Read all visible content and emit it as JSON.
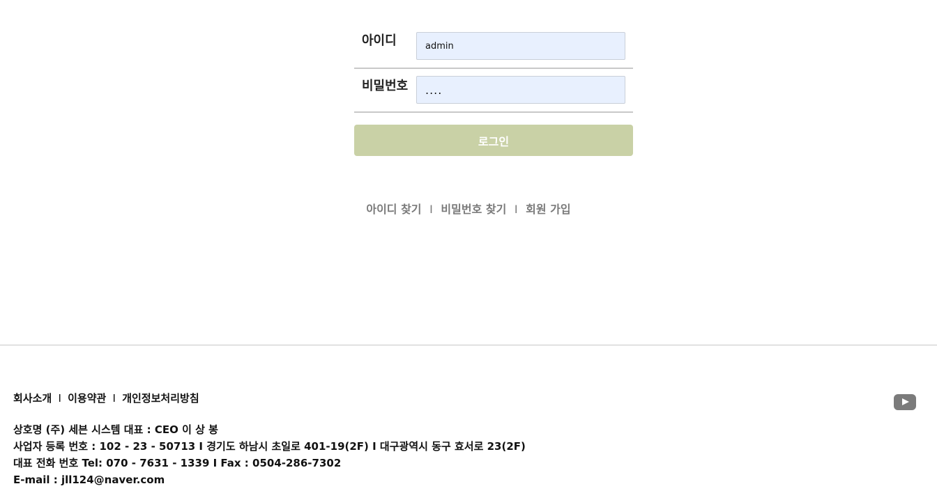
{
  "login": {
    "id_label": "아이디",
    "id_value": "admin",
    "pw_label": "비밀번호",
    "pw_value": "....",
    "button_label": "로그인",
    "button_color": "#c9d1a6",
    "input_background": "#e8f0fe"
  },
  "find_links": {
    "find_id": "아이디 찾기",
    "find_pw": "비밀번호 찾기",
    "signup": "회원 가입",
    "separator": "I"
  },
  "footer": {
    "links": {
      "about": "회사소개",
      "terms": "이용약관",
      "privacy": "개인정보처리방침",
      "separator": "I"
    },
    "company": {
      "line1": "상호명 (주) 세븐 시스템 대표 : CEO 이 상 봉",
      "line2": "사업자 등록 번호 : 102 - 23 - 50713 I 경기도 하남시 초일로 401-19(2F) I 대구광역시 동구 효서로 23(2F)",
      "line3": "대표 전화 번호 Tel: 070 - 7631 - 1339 I Fax : 0504-286-7302",
      "line4": "E-mail : jll124@naver.com"
    },
    "social_icon": "youtube-icon"
  }
}
